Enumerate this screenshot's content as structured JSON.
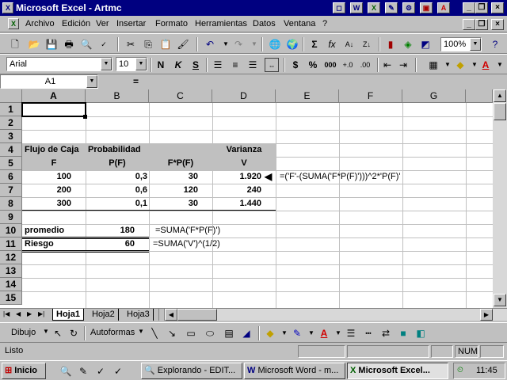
{
  "window": {
    "title": "Microsoft Excel - Artmc",
    "min_label": "_",
    "restore_label": "❐",
    "close_label": "×"
  },
  "menu": {
    "items": [
      "Archivo",
      "Edición",
      "Ver",
      "Insertar",
      "Formato",
      "Herramientas",
      "Datos",
      "Ventana",
      "?"
    ]
  },
  "formatting": {
    "font": "Arial",
    "size": "10",
    "bold": "N",
    "italic": "K",
    "underline": "S",
    "currency": "$",
    "percent": "%",
    "thousands": "000"
  },
  "standard": {
    "zoom": "100%"
  },
  "formula_bar": {
    "name_box": "A1",
    "equals": "=",
    "content": ""
  },
  "columns": [
    "A",
    "B",
    "C",
    "D",
    "E",
    "F",
    "G"
  ],
  "rows": [
    "1",
    "2",
    "3",
    "4",
    "5",
    "6",
    "7",
    "8",
    "9",
    "10",
    "11",
    "12",
    "13",
    "14",
    "15"
  ],
  "sheet": {
    "r4": {
      "a": "Flujo de Caja",
      "b": "Probabilidad",
      "d": "Varianza"
    },
    "r5": {
      "a": "F",
      "b": "P(F)",
      "c": "F*P(F)",
      "d": "V"
    },
    "r6": {
      "a": "100",
      "b": "0,3",
      "c": "30",
      "d": "1.920",
      "note": "=('F'-(SUMA('F*P(F)')))^2*'P(F)'"
    },
    "r7": {
      "a": "200",
      "b": "0,6",
      "c": "120",
      "d": "240"
    },
    "r8": {
      "a": "300",
      "b": "0,1",
      "c": "30",
      "d": "1.440"
    },
    "r10": {
      "a": "promedio",
      "b": "180",
      "note": "=SUMA('F*P(F)')"
    },
    "r11": {
      "a": "Riesgo",
      "b": "60",
      "note": "=SUMA('V')^(1/2)"
    }
  },
  "tabs": [
    "Hoja1",
    "Hoja2",
    "Hoja3"
  ],
  "drawing": {
    "dibujo": "Dibujo",
    "autoformas": "Autoformas"
  },
  "status": {
    "text": "Listo",
    "num": "NUM"
  },
  "taskbar": {
    "start": "Inicio",
    "tasks": [
      "Explorando - EDIT...",
      "Microsoft Word - m...",
      "Microsoft Excel..."
    ],
    "clock": "11:45"
  },
  "colors": {
    "title_bg": "#000080",
    "selection_border": "#000000"
  }
}
